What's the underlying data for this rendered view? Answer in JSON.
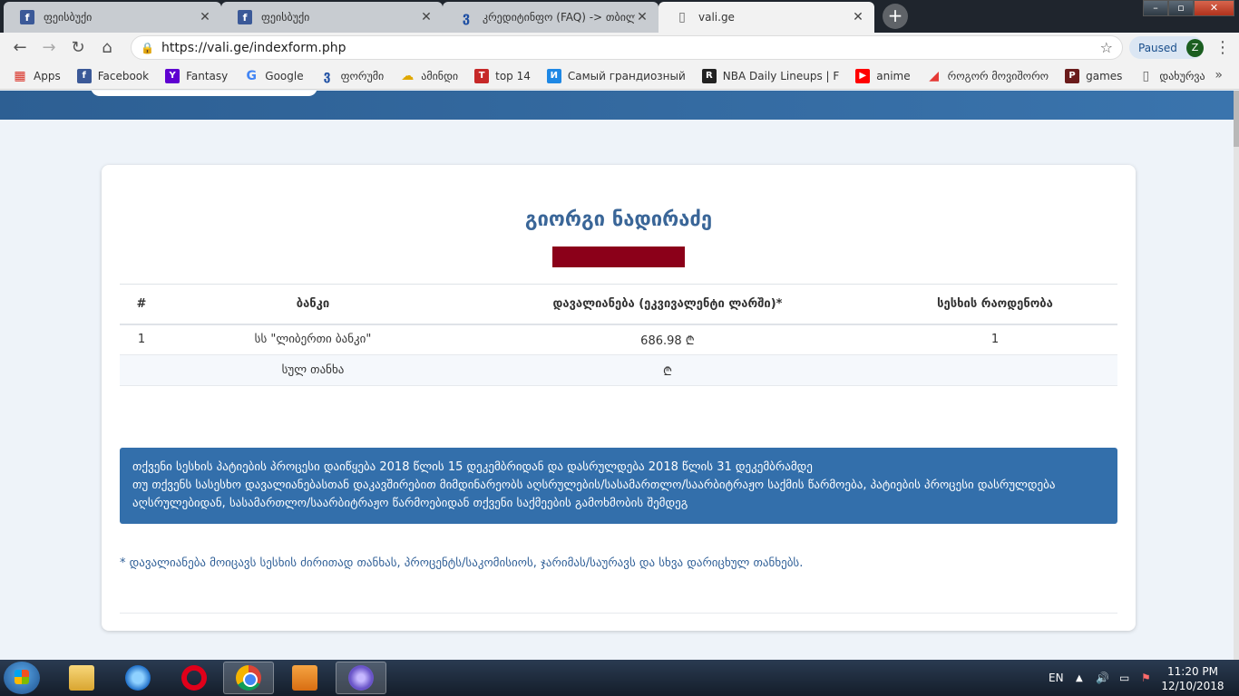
{
  "browser": {
    "tabs": [
      {
        "title": "ფეისბუქი",
        "icon": "facebook-icon"
      },
      {
        "title": "ფეისბუქი",
        "icon": "facebook-icon"
      },
      {
        "title": "კრედიტინფო (FAQ) -> თბილისი",
        "icon": "forum-3-icon"
      },
      {
        "title": "vali.ge",
        "icon": "page-icon"
      }
    ],
    "url": "https://vali.ge/indexform.php",
    "profile_status": "Paused",
    "profile_initial": "Z",
    "bookmarks": [
      {
        "label": "Apps",
        "icon": "apps-grid-icon"
      },
      {
        "label": "Facebook",
        "icon": "facebook-icon"
      },
      {
        "label": "Fantasy",
        "icon": "yahoo-icon"
      },
      {
        "label": "Google",
        "icon": "google-icon"
      },
      {
        "label": "ფორუმი",
        "icon": "forum-3-icon"
      },
      {
        "label": "ამინდი",
        "icon": "weather-icon"
      },
      {
        "label": "top 14",
        "icon": "top14-icon"
      },
      {
        "label": "Самый грандиозный",
        "icon": "smy-icon"
      },
      {
        "label": "NBA Daily Lineups | F",
        "icon": "nba-icon"
      },
      {
        "label": "anime",
        "icon": "youtube-icon"
      },
      {
        "label": "როგორ მოვიშორო",
        "icon": "rog-icon"
      },
      {
        "label": "games",
        "icon": "pog-icon"
      },
      {
        "label": "დახურვა",
        "icon": "page-icon"
      }
    ]
  },
  "page": {
    "person_name": "გიორგი ნადირაძე",
    "table": {
      "headers": [
        "#",
        "ბანკი",
        "დავალიანება (ეკვივალენტი ლარში)*",
        "სესხის რაოდენობა"
      ],
      "rows": [
        [
          "1",
          "სს \"ლიბერთი ბანკი\"",
          "686.98 ₾",
          "1"
        ]
      ],
      "total_label": "სულ თანხა",
      "total_amount": "₾"
    },
    "notice_line1": "თქვენი სესხის პატიების პროცესი დაიწყება 2018 წლის 15 დეკემბრიდან და დასრულდება 2018 წლის 31 დეკემბრამდე",
    "notice_line2": "თუ თქვენს სასესხო დავალიანებასთან დაკავშირებით მიმდინარეობს აღსრულების/სასამართლო/საარბიტრაჟო საქმის წარმოება, პატიების პროცესი დასრულდება აღსრულებიდან, სასამართლო/საარბიტრაჟო წარმოებიდან თქვენი საქმეების გამოხმობის შემდეგ",
    "footnote": "* დავალიანება მოიცავს სესხის ძირითად თანხას, პროცენტს/საკომისიოს, ჯარიმას/საურავს და სხვა დარიცხულ თანხებს.",
    "colors": {
      "accent": "#336fab",
      "title": "#3a6698",
      "redaction": "#8b0019"
    }
  },
  "taskbar": {
    "language": "EN",
    "time": "11:20 PM",
    "date": "12/10/2018"
  }
}
